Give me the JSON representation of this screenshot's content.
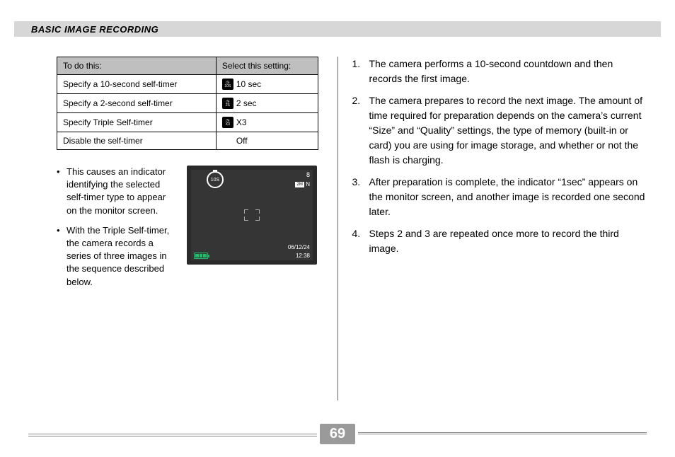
{
  "header": {
    "title": "BASIC IMAGE RECORDING"
  },
  "table": {
    "head": {
      "col1": "To do this:",
      "col2": "Select this setting:"
    },
    "rows": [
      {
        "action": "Specify a 10-second self-timer",
        "icon_sub": "10S",
        "label": "10 sec"
      },
      {
        "action": "Specify a 2-second self-timer",
        "icon_sub": "2S",
        "label": "2 sec"
      },
      {
        "action": "Specify Triple Self-timer",
        "icon_sub": "X3",
        "label": "X3"
      },
      {
        "action": "Disable the self-timer",
        "icon_sub": "",
        "label": "Off"
      }
    ]
  },
  "bullets": [
    "This causes an indicator identifying the selected self-timer type to appear on the monitor screen.",
    "With the Triple Self-timer, the camera records a series of three images in the sequence described below."
  ],
  "lcd": {
    "timer_label": "10S",
    "shots_remaining": "8",
    "size_badge": "2M",
    "quality": "N",
    "date": "06/12/24",
    "time": "12:38"
  },
  "steps": [
    "The camera performs a 10-second countdown and then records the first image.",
    "The camera prepares to record the next image. The amount of time required for preparation depends on the camera’s current “Size” and “Quality” settings, the type of memory (built-in or card) you are using for image storage, and whether or not the flash is charging.",
    "After preparation is complete, the indicator “1sec” appears on the monitor screen, and another image is recorded one second later.",
    "Steps 2 and 3 are repeated once more to record the third image."
  ],
  "page_number": "69"
}
